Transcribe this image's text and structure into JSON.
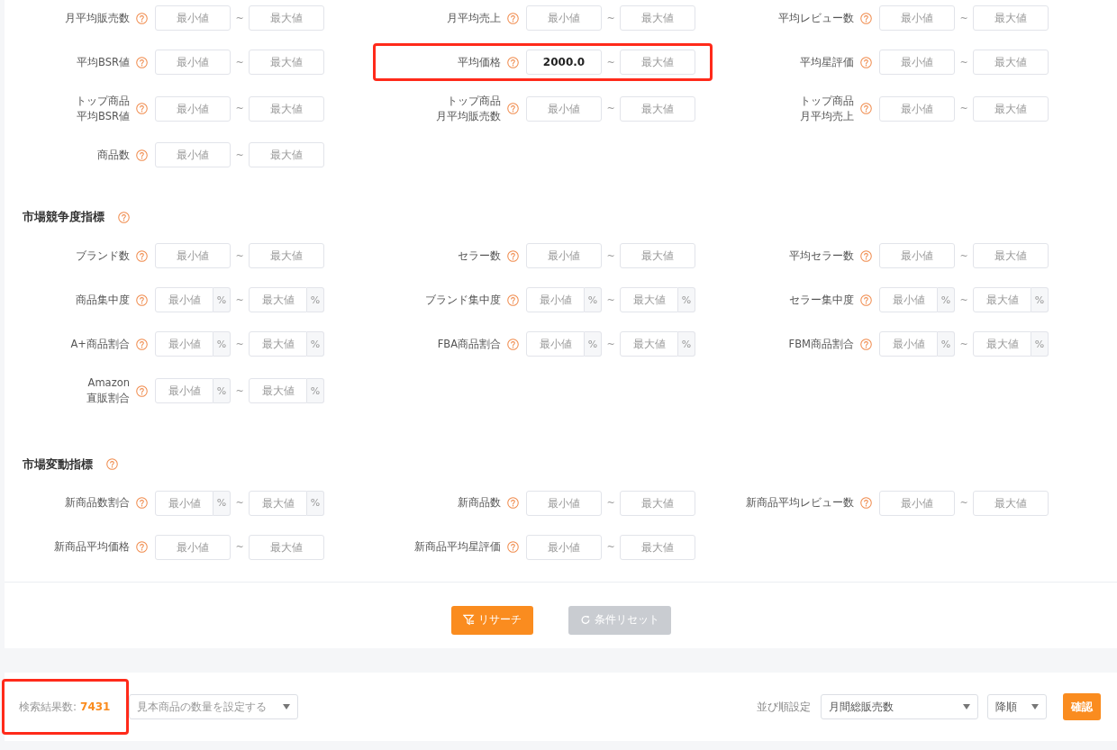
{
  "sections": [
    {
      "fields": [
        {
          "label": [
            "月平均販売数"
          ],
          "min": {
            "placeholder": "最小値"
          },
          "max": {
            "placeholder": "最大値"
          },
          "separator": "~"
        },
        {
          "label": [
            "月平均売上"
          ],
          "min": {
            "placeholder": "最小値"
          },
          "max": {
            "placeholder": "最大値"
          },
          "separator": "~"
        },
        {
          "label": [
            "平均レビュー数"
          ],
          "min": {
            "placeholder": "最小値"
          },
          "max": {
            "placeholder": "最大値"
          },
          "separator": "~"
        },
        {
          "label": [
            "平均BSR値"
          ],
          "min": {
            "placeholder": "最小値"
          },
          "max": {
            "placeholder": "最大値"
          },
          "separator": "~"
        },
        {
          "label": [
            "平均価格"
          ],
          "min": {
            "value": "2000.0"
          },
          "max": {
            "placeholder": "最大値"
          },
          "separator": "~",
          "highlighted": true
        },
        {
          "label": [
            "平均星評価"
          ],
          "min": {
            "placeholder": "最小値"
          },
          "max": {
            "placeholder": "最大値"
          },
          "separator": "~"
        },
        {
          "label": [
            "トップ商品",
            "平均BSR値"
          ],
          "min": {
            "placeholder": "最小値"
          },
          "max": {
            "placeholder": "最大値"
          },
          "separator": "~"
        },
        {
          "label": [
            "トップ商品",
            "月平均販売数"
          ],
          "min": {
            "placeholder": "最小値"
          },
          "max": {
            "placeholder": "最大値"
          },
          "separator": "~"
        },
        {
          "label": [
            "トップ商品",
            "月平均売上"
          ],
          "min": {
            "placeholder": "最小値"
          },
          "max": {
            "placeholder": "最大値"
          },
          "separator": "~"
        },
        {
          "label": [
            "商品数"
          ],
          "min": {
            "placeholder": "最小値"
          },
          "max": {
            "placeholder": "最大値"
          },
          "separator": "~"
        }
      ]
    },
    {
      "title": "市場競争度指標",
      "fields": [
        {
          "label": [
            "ブランド数"
          ],
          "min": {
            "placeholder": "最小値"
          },
          "max": {
            "placeholder": "最大値"
          },
          "separator": "~"
        },
        {
          "label": [
            "セラー数"
          ],
          "min": {
            "placeholder": "最小値"
          },
          "max": {
            "placeholder": "最大値"
          },
          "separator": "~"
        },
        {
          "label": [
            "平均セラー数"
          ],
          "min": {
            "placeholder": "最小値"
          },
          "max": {
            "placeholder": "最大値"
          },
          "separator": "~"
        },
        {
          "label": [
            "商品集中度"
          ],
          "min": {
            "placeholder": "最小値"
          },
          "max": {
            "placeholder": "最大値"
          },
          "separator": "~",
          "unit": "%"
        },
        {
          "label": [
            "ブランド集中度"
          ],
          "min": {
            "placeholder": "最小値"
          },
          "max": {
            "placeholder": "最大値"
          },
          "separator": "~",
          "unit": "%"
        },
        {
          "label": [
            "セラー集中度"
          ],
          "min": {
            "placeholder": "最小値"
          },
          "max": {
            "placeholder": "最大値"
          },
          "separator": "~",
          "unit": "%"
        },
        {
          "label": [
            "A+商品割合"
          ],
          "min": {
            "placeholder": "最小値"
          },
          "max": {
            "placeholder": "最大値"
          },
          "separator": "~",
          "unit": "%"
        },
        {
          "label": [
            "FBA商品割合"
          ],
          "min": {
            "placeholder": "最小値"
          },
          "max": {
            "placeholder": "最大値"
          },
          "separator": "~",
          "unit": "%"
        },
        {
          "label": [
            "FBM商品割合"
          ],
          "min": {
            "placeholder": "最小値"
          },
          "max": {
            "placeholder": "最大値"
          },
          "separator": "~",
          "unit": "%"
        },
        {
          "label": [
            "Amazon",
            "直販割合"
          ],
          "min": {
            "placeholder": "最小値"
          },
          "max": {
            "placeholder": "最大値"
          },
          "separator": "~",
          "unit": "%"
        }
      ]
    },
    {
      "title": "市場変動指標",
      "fields": [
        {
          "label": [
            "新商品数割合"
          ],
          "min": {
            "placeholder": "最小値"
          },
          "max": {
            "placeholder": "最大値"
          },
          "separator": "~",
          "unit": "%"
        },
        {
          "label": [
            "新商品数"
          ],
          "min": {
            "placeholder": "最小値"
          },
          "max": {
            "placeholder": "最大値"
          },
          "separator": "~"
        },
        {
          "label": [
            "新商品平均レビュー数"
          ],
          "min": {
            "placeholder": "最小値"
          },
          "max": {
            "placeholder": "最大値"
          },
          "separator": "~"
        },
        {
          "label": [
            "新商品平均価格"
          ],
          "min": {
            "placeholder": "最小値"
          },
          "max": {
            "placeholder": "最大値"
          },
          "separator": "~"
        },
        {
          "label": [
            "新商品平均星評価"
          ],
          "min": {
            "placeholder": "最小値"
          },
          "max": {
            "placeholder": "最大値"
          },
          "separator": "~"
        }
      ]
    }
  ],
  "actions": [
    {
      "label": "リサーチ",
      "kind": "search",
      "disabled": false
    },
    {
      "label": "条件リセット",
      "kind": "reset",
      "disabled": true
    }
  ],
  "results": {
    "label": "検索結果数:",
    "count": "7431",
    "highlighted": true,
    "sample_select": {
      "placeholder": "見本商品の数量を設定する"
    },
    "sort_label": "並び順設定",
    "sort_field": {
      "value": "月間総販売数"
    },
    "sort_order": {
      "value": "降順"
    },
    "confirm": "確認"
  }
}
